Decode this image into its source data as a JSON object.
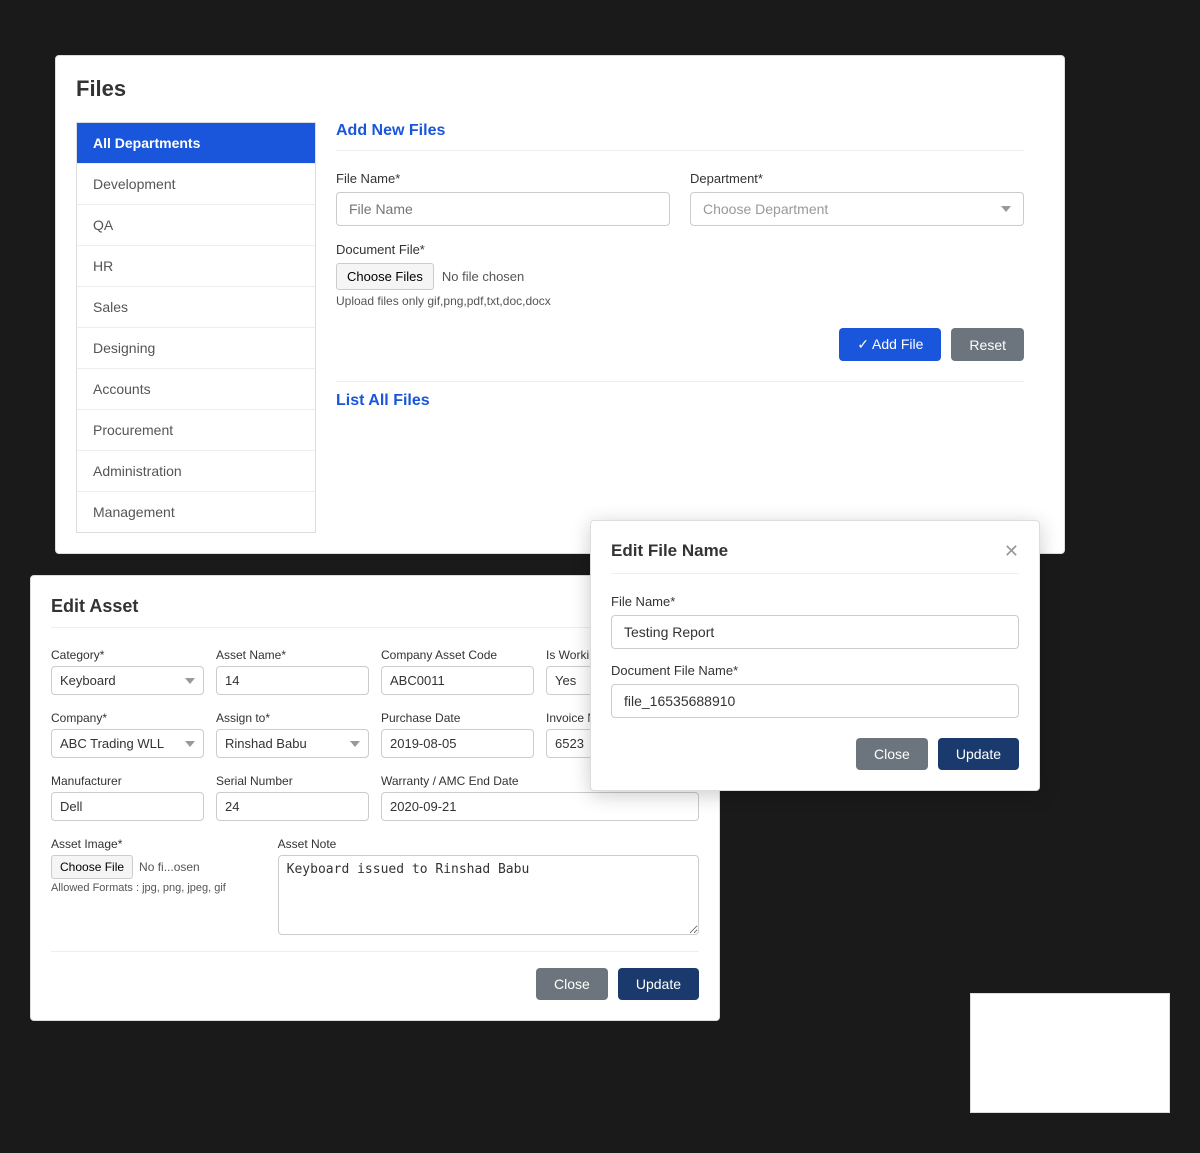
{
  "filesPanel": {
    "title": "Files",
    "addNewLabel": "Add New",
    "filesLabel": "Files",
    "sidebar": {
      "items": [
        {
          "id": "all-departments",
          "label": "All Departments",
          "active": true
        },
        {
          "id": "development",
          "label": "Development",
          "active": false
        },
        {
          "id": "qa",
          "label": "QA",
          "active": false
        },
        {
          "id": "hr",
          "label": "HR",
          "active": false
        },
        {
          "id": "sales",
          "label": "Sales",
          "active": false
        },
        {
          "id": "designing",
          "label": "Designing",
          "active": false
        },
        {
          "id": "accounts",
          "label": "Accounts",
          "active": false
        },
        {
          "id": "procurement",
          "label": "Procurement",
          "active": false
        },
        {
          "id": "administration",
          "label": "Administration",
          "active": false
        },
        {
          "id": "management",
          "label": "Management",
          "active": false
        }
      ]
    },
    "form": {
      "fileNameLabel": "File Name*",
      "fileNamePlaceholder": "File Name",
      "departmentLabel": "Department*",
      "departmentPlaceholder": "Choose Department",
      "documentFileLabel": "Document File*",
      "chooseFilesLabel": "Choose Files",
      "noFileText": "No file chosen",
      "uploadHint": "Upload files only gif,png,pdf,txt,doc,docx",
      "addFileLabel": "✓ Add File",
      "resetLabel": "Reset"
    },
    "listLabel": "List All",
    "listFilesLabel": "Files"
  },
  "editAssetPanel": {
    "title": "Edit Asset",
    "fields": {
      "categoryLabel": "Category*",
      "categoryValue": "Keyboard",
      "assetNameLabel": "Asset Name*",
      "assetNameValue": "14",
      "companyAssetCodeLabel": "Company Asset Code",
      "companyAssetCodeValue": "ABC0011",
      "isWorkingLabel": "Is Working?",
      "isWorkingValue": "Yes",
      "companyLabel": "Company*",
      "companyValue": "ABC Trading WLL",
      "assignToLabel": "Assign to*",
      "assignToValue": "Rinshad Babu",
      "purchaseDateLabel": "Purchase Date",
      "purchaseDateValue": "2019-08-05",
      "invoiceNumLabel": "Invoice Num",
      "invoiceNumValue": "6523",
      "manufacturerLabel": "Manufacturer",
      "manufacturerValue": "Dell",
      "serialNumberLabel": "Serial Number",
      "serialNumberValue": "24",
      "warrantyLabel": "Warranty / AMC End Date",
      "warrantyValue": "2020-09-21",
      "assetImageLabel": "Asset Image*",
      "chooseFileLabel": "Choose File",
      "noFileText": "No fi...osen",
      "allowedFormats": "Allowed Formats : jpg, png, jpeg, gif",
      "assetNoteLabel": "Asset Note",
      "assetNoteValue": "Keyboard issued to Rinshad Babu"
    },
    "closeLabel": "Close",
    "updateLabel": "Update"
  },
  "editFileModal": {
    "title": "Edit File Name",
    "fileNameLabel": "File Name*",
    "fileNameValue": "Testing Report",
    "documentFileNameLabel": "Document File Name*",
    "documentFileNameValue": "file_16535688910",
    "closeLabel": "Close",
    "updateLabel": "Update"
  }
}
